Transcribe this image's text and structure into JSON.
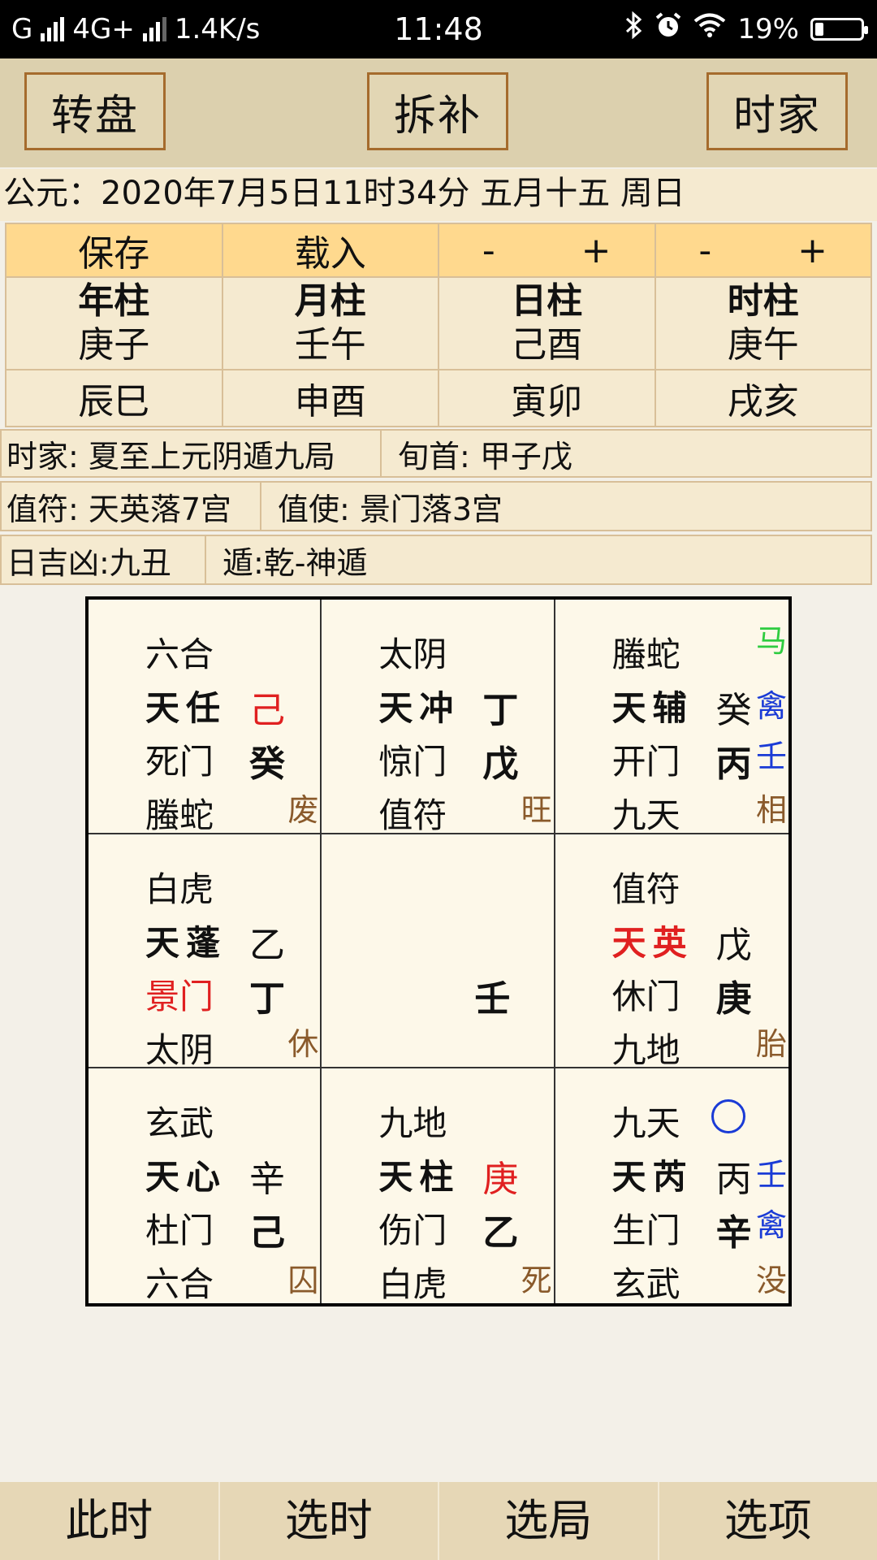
{
  "status": {
    "carrier": "G",
    "network": "4G+",
    "speed": "1.4K/s",
    "time": "11:48",
    "battery": "19%",
    "battery_level": 0.19,
    "icons": [
      "signal-icon",
      "bluetooth-icon",
      "alarm-icon",
      "wifi-icon",
      "battery-icon"
    ]
  },
  "toolbar": {
    "btn1": "转盘",
    "btn2": "拆补",
    "btn3": "时家"
  },
  "date_line": "公元：2020年7月5日11时34分 五月十五 周日",
  "controls": {
    "save": "保存",
    "load": "载入",
    "minus": "-",
    "plus": "+"
  },
  "pillars": [
    {
      "label": "年柱",
      "ganzhi": "庚子",
      "kong": "辰巳"
    },
    {
      "label": "月柱",
      "ganzhi": "壬午",
      "kong": "申酉"
    },
    {
      "label": "日柱",
      "ganzhi": "己酉",
      "kong": "寅卯"
    },
    {
      "label": "时柱",
      "ganzhi": "庚午",
      "kong": "戌亥"
    }
  ],
  "info": {
    "ju": "时家: 夏至上元阴遁九局",
    "xunshou": "旬首: 甲子戊",
    "zhifu": "值符: 天英落7宫",
    "zhishi": "值使: 景门落3宫",
    "jixiong": "日吉凶:九丑",
    "dun": "遁:乾-神遁"
  },
  "palaces": [
    {
      "god": "六合",
      "star": "天任",
      "star_stem": "己",
      "door": "死门",
      "door_stem": "癸",
      "sub": "螣蛇",
      "state": "废"
    },
    {
      "god": "太阴",
      "star": "天冲",
      "star_stem": "丁",
      "door": "惊门",
      "door_stem": "戊",
      "sub": "值符",
      "state": "旺"
    },
    {
      "god": "螣蛇",
      "star": "天辅",
      "star_stem": "癸",
      "door": "开门",
      "door_stem": "丙",
      "sub": "九天",
      "state": "相",
      "side1": "马",
      "side2": "禽",
      "side3": "壬"
    },
    {
      "god": "白虎",
      "star": "天蓬",
      "star_stem": "乙",
      "door": "景门",
      "door_stem": "丁",
      "sub": "太阴",
      "state": "休"
    },
    {
      "center_stem": "壬"
    },
    {
      "god": "值符",
      "star": "天英",
      "star_stem": "戊",
      "door": "休门",
      "door_stem": "庚",
      "sub": "九地",
      "state": "胎"
    },
    {
      "god": "玄武",
      "star": "天心",
      "star_stem": "辛",
      "door": "杜门",
      "door_stem": "己",
      "sub": "六合",
      "state": "囚"
    },
    {
      "god": "九地",
      "star": "天柱",
      "star_stem": "庚",
      "door": "伤门",
      "door_stem": "乙",
      "sub": "白虎",
      "state": "死"
    },
    {
      "god": "九天",
      "star": "天芮",
      "star_stem": "丙",
      "door": "生门",
      "door_stem": "辛",
      "sub": "玄武",
      "state": "没",
      "side2": "壬",
      "side3": "禽"
    }
  ],
  "colors": {
    "highlight_red": "#e02020",
    "blue": "#1a3bd6",
    "green": "#2ecc40",
    "state_brown": "#8a5a2b"
  },
  "bottom_nav": {
    "now": "此时",
    "pick_time": "选时",
    "pick_ju": "选局",
    "options": "选项"
  }
}
